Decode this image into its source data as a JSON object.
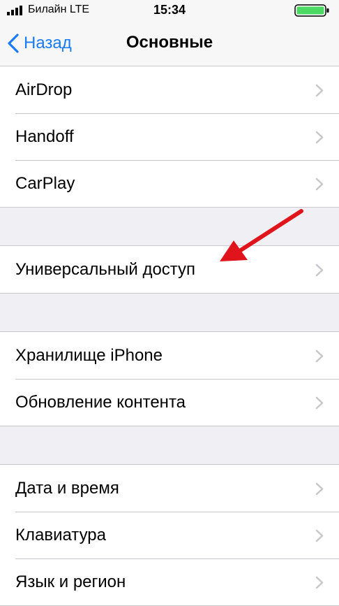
{
  "status_bar": {
    "carrier": "Билайн  LTE",
    "time": "15:34"
  },
  "nav": {
    "back_label": "Назад",
    "title": "Основные"
  },
  "groups": [
    {
      "items": [
        "AirDrop",
        "Handoff",
        "CarPlay"
      ]
    },
    {
      "items": [
        "Универсальный доступ"
      ]
    },
    {
      "items": [
        "Хранилище iPhone",
        "Обновление контента"
      ]
    },
    {
      "items": [
        "Дата и время",
        "Клавиатура",
        "Язык и регион"
      ]
    }
  ],
  "colors": {
    "accent": "#1a7cf5",
    "battery": "#4cd964",
    "annotation_arrow": "#e0141b",
    "background": "#efeff4"
  },
  "icons": [
    "signal-icon",
    "battery-icon",
    "back-chevron-icon",
    "chevron-right-icon",
    "annotation-arrow-icon"
  ]
}
